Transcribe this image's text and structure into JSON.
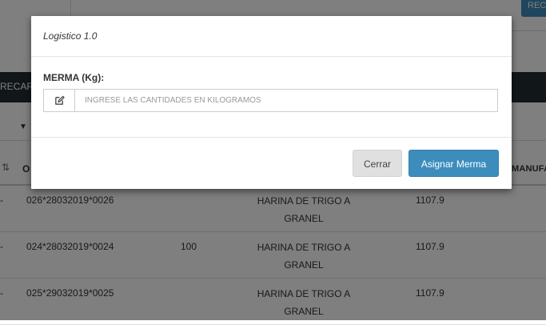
{
  "background": {
    "top_button_label": "REC",
    "bar_label": "RECAR",
    "header": {
      "col_o": "O",
      "col_manuf": "MANUFA"
    },
    "rows": [
      {
        "code": "026*28032019*0026",
        "qty": "",
        "product": "HARINA DE TRIGO A GRANEL",
        "price": "1107.9"
      },
      {
        "code": "024*28032019*0024",
        "qty": "100",
        "product": "HARINA DE TRIGO A GRANEL",
        "price": "1107.9"
      },
      {
        "code": "025*29032019*0025",
        "qty": "",
        "product": "HARINA DE TRIGO A GRANEL",
        "price": "1107.9"
      }
    ]
  },
  "modal": {
    "title": "Logistico 1.0",
    "field_label": "MERMA (Kg):",
    "field_icon": "edit-icon",
    "input_value": "",
    "input_placeholder": "INGRESE LAS CANTIDADES EN KILOGRAMOS",
    "close_label": "Cerrar",
    "assign_label": "Asignar Merma",
    "accent_color": "#3c8dbc"
  }
}
